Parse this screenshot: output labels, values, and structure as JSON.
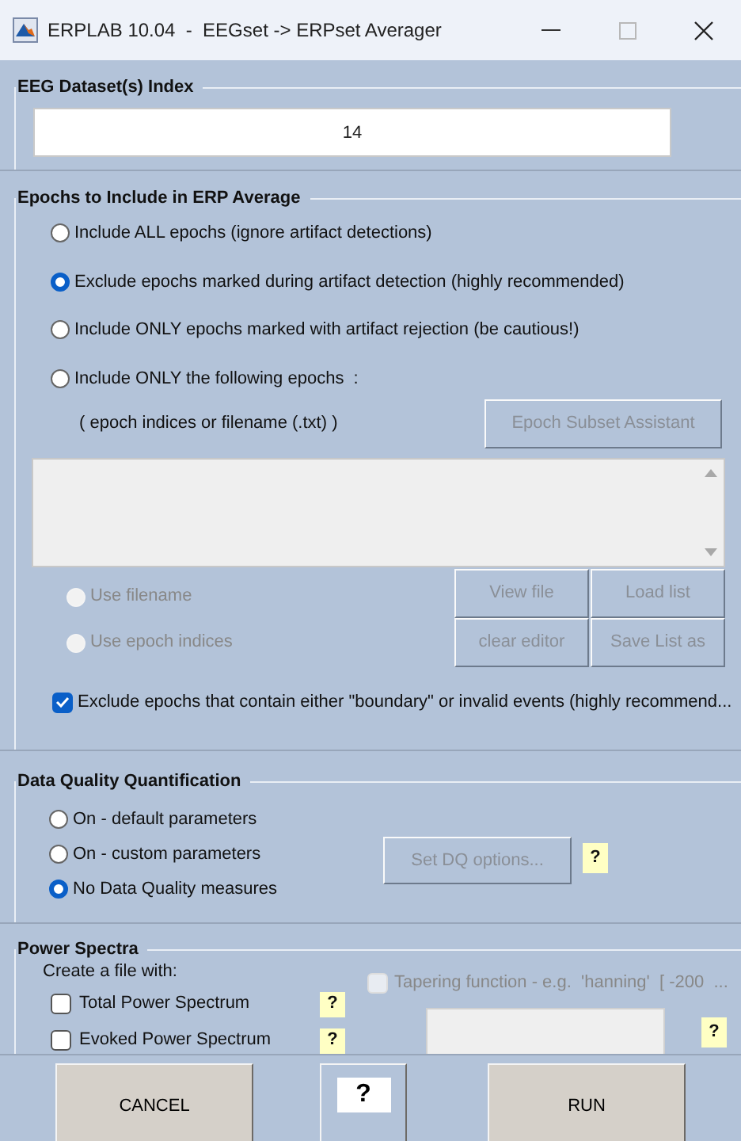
{
  "window": {
    "title": "ERPLAB 10.04  -  EEGset -> ERPset Averager"
  },
  "dataset_panel": {
    "title": "EEG Dataset(s) Index",
    "value": "14"
  },
  "epochs_panel": {
    "title": "Epochs to Include in ERP Average",
    "options": [
      {
        "label": "Include ALL epochs (ignore artifact detections)",
        "selected": false
      },
      {
        "label": "Exclude epochs marked during artifact detection (highly recommended)",
        "selected": true
      },
      {
        "label": "Include ONLY epochs marked with artifact rejection (be cautious!)",
        "selected": false
      },
      {
        "label": "Include ONLY the following epochs  :",
        "selected": false
      }
    ],
    "hint": "( epoch indices or filename (.txt) )",
    "assistant_button": {
      "label": "Epoch Subset Assistant",
      "disabled": true
    },
    "source_options": [
      {
        "label": "Use filename",
        "selected": false,
        "disabled": true
      },
      {
        "label": "Use epoch indices",
        "selected": false,
        "disabled": true
      }
    ],
    "file_buttons": [
      {
        "label": "View file",
        "disabled": true
      },
      {
        "label": "Load list",
        "disabled": true
      },
      {
        "label": "clear editor",
        "disabled": true
      },
      {
        "label": "Save List as",
        "disabled": true
      }
    ],
    "boundary_checkbox": {
      "label": "Exclude epochs that contain either \"boundary\" or invalid events (highly recommend...",
      "checked": true
    }
  },
  "dq_panel": {
    "title": "Data Quality Quantification",
    "options": [
      {
        "label": "On - default parameters",
        "selected": false
      },
      {
        "label": "On - custom parameters",
        "selected": false
      },
      {
        "label": "No Data Quality measures",
        "selected": true
      }
    ],
    "options_button": {
      "label": "Set DQ options...",
      "disabled": true
    },
    "help": "?"
  },
  "spectra_panel": {
    "title": "Power Spectra",
    "caption": "Create a file with:",
    "checkboxes": [
      {
        "label": "Total Power Spectrum",
        "checked": false,
        "help": "?"
      },
      {
        "label": "Evoked Power Spectrum",
        "checked": false,
        "help": "?"
      }
    ],
    "taper": {
      "label": "Tapering function - e.g.  'hanning'  [ -200  ...",
      "checked": false,
      "disabled": true
    },
    "taper_help": "?"
  },
  "footer": {
    "buttons": [
      {
        "label": "CANCEL",
        "kind": "plain"
      },
      {
        "label": "?",
        "kind": "help"
      },
      {
        "label": "RUN",
        "kind": "plain"
      }
    ]
  }
}
